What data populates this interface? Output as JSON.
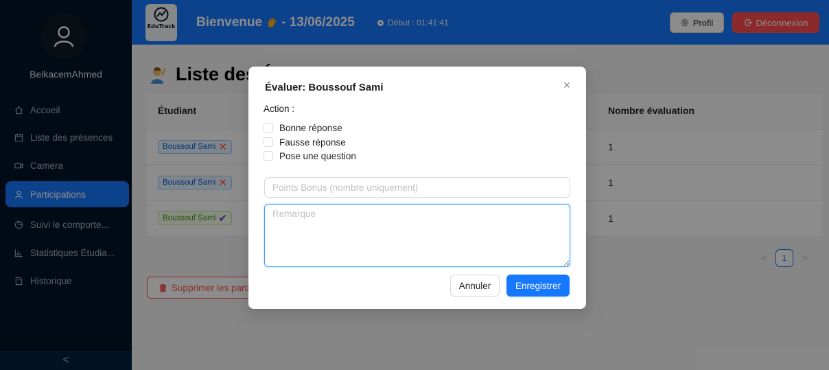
{
  "sidebar": {
    "username": "BelkacemAhmed",
    "items": [
      {
        "label": "Accueil",
        "icon": "home-icon"
      },
      {
        "label": "Liste des présences",
        "icon": "calendar-icon"
      },
      {
        "label": "Camera",
        "icon": "video-camera-icon"
      },
      {
        "label": "Participations",
        "icon": "user-icon",
        "active": true
      },
      {
        "label": "Suivi le comporte...",
        "icon": "pie-chart-icon"
      },
      {
        "label": "Statistiques Étudia...",
        "icon": "bar-chart-icon"
      },
      {
        "label": "Historique",
        "icon": "file-icon"
      }
    ],
    "collapse_glyph": "<"
  },
  "header": {
    "logo_text": "EduTrack",
    "welcome_prefix": "Bienvenue",
    "welcome_date": "- 13/06/2025",
    "start_time": "Début : 01:41:41",
    "profile_label": "Profil",
    "logout_label": "Déconnexion"
  },
  "page": {
    "title": "Liste des Étudiants avec leurs évaluations",
    "columns": [
      "Étudiant",
      "Nombre évaluation"
    ],
    "rows": [
      {
        "student": "Boussouf Sami",
        "mark": "✕",
        "count": "1"
      },
      {
        "student": "Boussouf Sami",
        "mark": "✕",
        "count": "1"
      },
      {
        "student": "Boussouf Sami",
        "mark": "✔",
        "count": "1"
      }
    ],
    "pagination": {
      "current": "1",
      "prev": "<",
      "next": ">"
    },
    "delete_label": "Supprimer les participations"
  },
  "modal": {
    "title": "Évaluer: Boussouf Sami",
    "close_glyph": "×",
    "action_label": "Action :",
    "options": [
      "Bonne réponse",
      "Fausse réponse",
      "Pose une question"
    ],
    "bonus_placeholder": "Points Bonus (nombre uniquement)",
    "remark_placeholder": "Remarque",
    "cancel_label": "Annuler",
    "save_label": "Enregistrer"
  },
  "colors": {
    "primary": "#1677ff",
    "sidebar": "#001529",
    "danger": "#ff4d4f",
    "success": "#389e0d"
  }
}
